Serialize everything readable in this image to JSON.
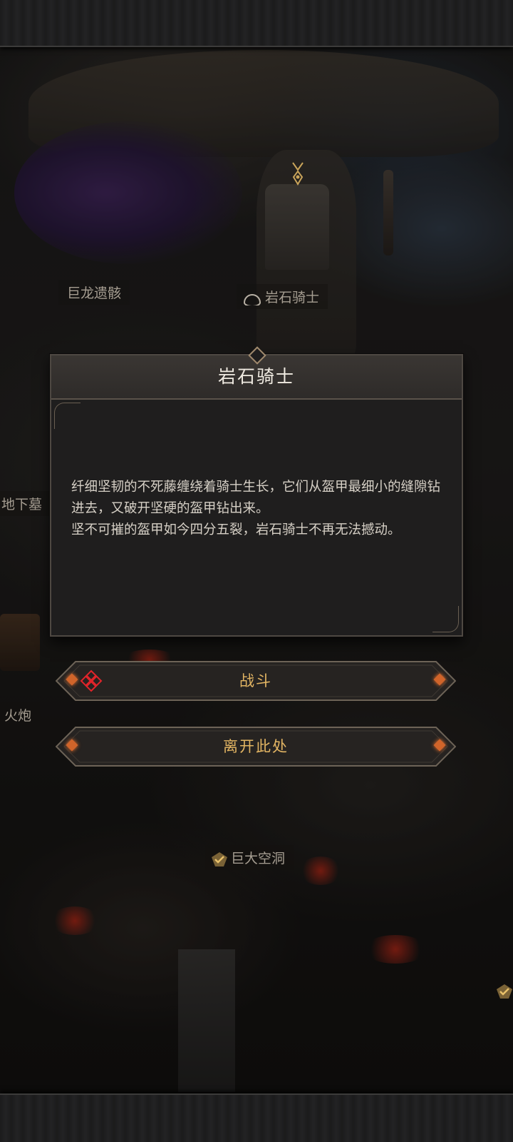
{
  "map": {
    "labels": {
      "dragon_remains": "巨龙遗骸",
      "rock_knight": "岩石骑士",
      "underground_tomb": "地下墓",
      "cannon": "火炮",
      "great_cavern": "巨大空洞"
    }
  },
  "dialog": {
    "title": "岩石骑士",
    "paragraph1": "纤细坚韧的不死藤缠绕着骑士生长，它们从盔甲最细小的缝隙钻进去，又破开坚硬的盔甲钻出来。",
    "paragraph2": "坚不可摧的盔甲如今四分五裂，岩石骑士不再无法撼动。"
  },
  "buttons": {
    "fight": "战斗",
    "leave": "离开此处"
  },
  "colors": {
    "accent_gold": "#e3b563",
    "gem_orange": "#d0642a",
    "danger_red": "#e0242a"
  },
  "icons": {
    "fight_badge": "crossed-swords-danger-icon",
    "cavern_check": "check-icon",
    "rock_knight_marker": "circle-marker-icon",
    "location_pin": "down-arrow-marker-icon"
  }
}
